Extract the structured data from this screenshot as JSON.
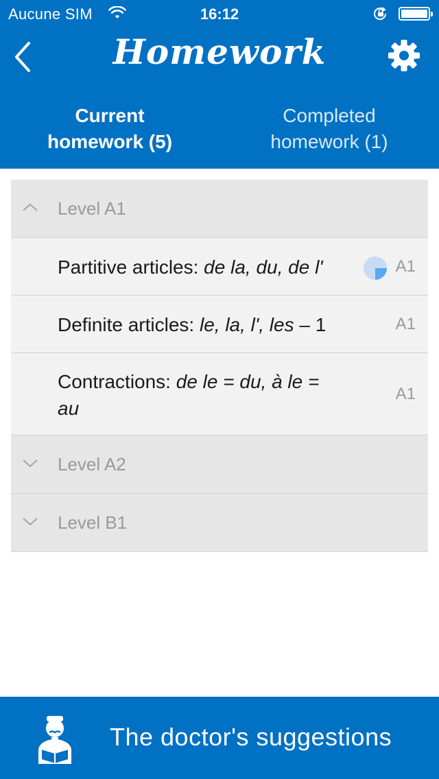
{
  "status_bar": {
    "carrier": "Aucune SIM",
    "time": "16:12"
  },
  "header": {
    "title": "Homework",
    "back_icon": "chevron-left-icon",
    "settings_icon": "gear-icon"
  },
  "tabs": [
    {
      "line1": "Current",
      "line2": "homework (5)",
      "selected": true
    },
    {
      "line1": "Completed",
      "line2": "homework (1)",
      "selected": false
    }
  ],
  "sections": [
    {
      "label": "Level A1",
      "expanded": true,
      "items": [
        {
          "title_plain": "Partitive articles: ",
          "title_italic": "de la, du, de l'",
          "title_suffix": "",
          "level": "A1",
          "progress": 0.25
        },
        {
          "title_plain": "Definite articles: ",
          "title_italic": "le, la, l', les",
          "title_suffix": " – 1",
          "level": "A1"
        },
        {
          "title_plain": "Contractions: ",
          "title_italic": "de le = du, à le =",
          "title_line2": "au",
          "level": "A1"
        }
      ]
    },
    {
      "label": "Level A2",
      "expanded": false
    },
    {
      "label": "Level B1",
      "expanded": false
    }
  ],
  "footer": {
    "label": "The doctor's suggestions",
    "icon": "doctor-reading-icon"
  },
  "colors": {
    "brand_blue": "#0171c4",
    "progress_blue": "#5aa8ee",
    "progress_track": "#c5dcf4"
  }
}
